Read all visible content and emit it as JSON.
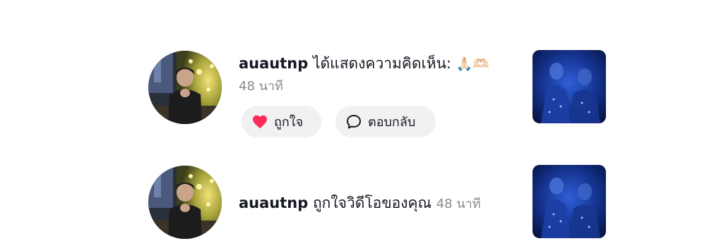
{
  "notifications": [
    {
      "username": "auautnp",
      "action": "ได้แสดงความคิดเห็น:",
      "comment_emoji": "🙏🏻🫶🏻",
      "time": "48 นาที",
      "like_label": "ถูกใจ",
      "reply_label": "ตอบกลับ",
      "avatar_icon": "user-avatar-photo",
      "thumbnail_icon": "video-thumbnail"
    },
    {
      "username": "auautnp",
      "action": "ถูกใจวิดีโอของคุณ",
      "time": "48 นาที",
      "avatar_icon": "user-avatar-photo",
      "thumbnail_icon": "video-thumbnail"
    }
  ],
  "colors": {
    "heart": "#fe2c55",
    "secondary_text": "#8a8b91",
    "pill_bg": "#f1f1f2",
    "thumbnail_blue": "#0f2a8a"
  }
}
